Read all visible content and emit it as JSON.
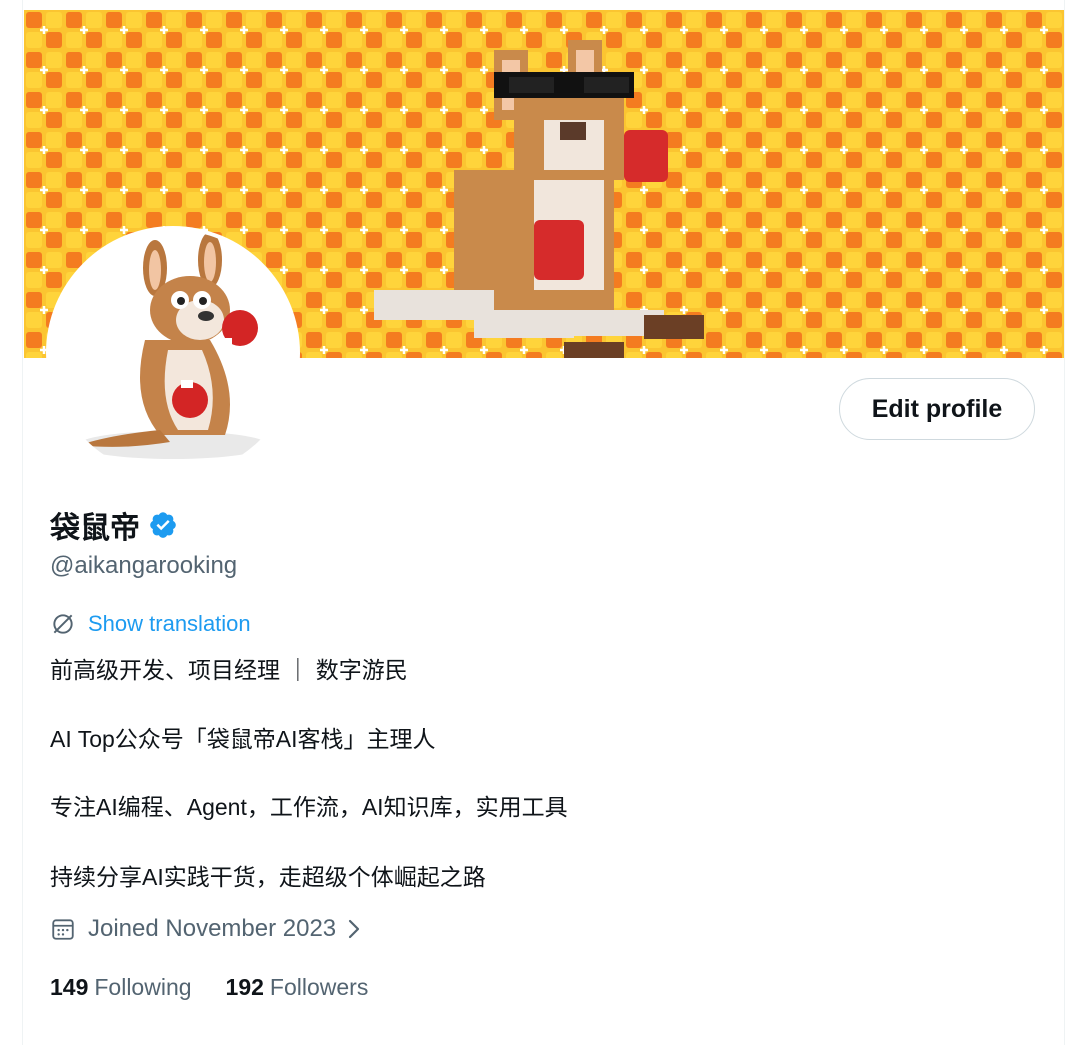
{
  "profile": {
    "display_name": "袋鼠帝",
    "handle": "@aikangarooking",
    "edit_button_label": "Edit profile",
    "translate_label": "Show translation",
    "bio_lines": [
      "前高级开发、项目经理 ｜ 数字游民",
      "AI Top公众号「袋鼠帝AI客栈」主理人",
      "专注AI编程、Agent，工作流，AI知识库，实用工具",
      "持续分享AI实践干货，走超级个体崛起之路"
    ],
    "joined": "Joined November 2023",
    "following_count": "149",
    "following_label": "Following",
    "followers_count": "192",
    "followers_label": "Followers"
  },
  "icons": {
    "verified": "verified-badge-icon",
    "translate": "translate-globe-icon",
    "calendar": "calendar-icon",
    "chevron": "chevron-right-icon"
  },
  "colors": {
    "accent": "#1d9bf0",
    "text_primary": "#0f1419",
    "text_secondary": "#536471",
    "banner_orange": "#f47c20",
    "banner_yellow": "#fbc531"
  }
}
